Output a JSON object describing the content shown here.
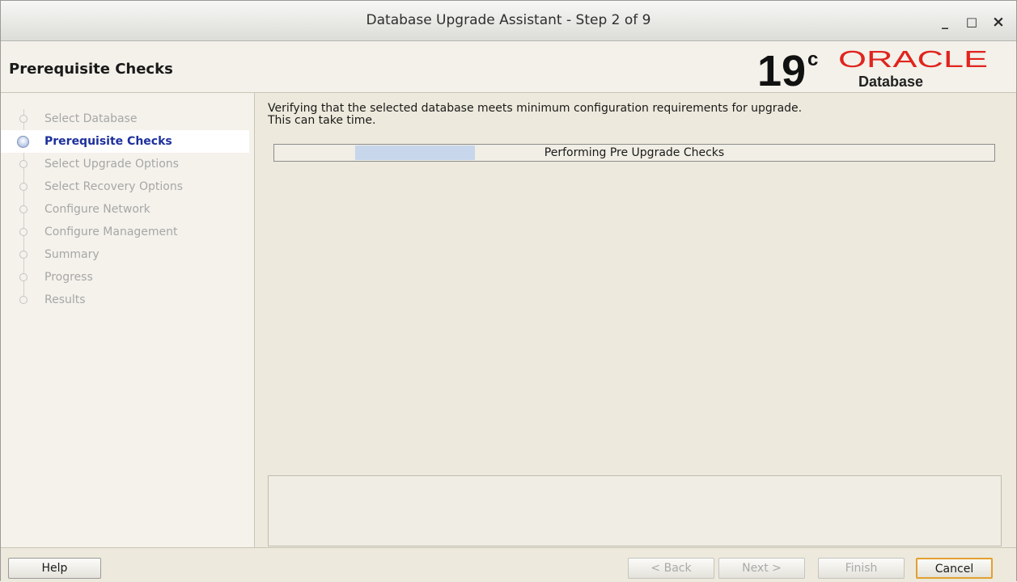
{
  "window": {
    "title": "Database Upgrade Assistant - Step 2 of 9",
    "minimize": "_",
    "maximize": "□",
    "close": "×"
  },
  "header": {
    "page_title": "Prerequisite Checks",
    "logo": {
      "version": "19",
      "version_sup": "c",
      "brand": "ORACLE",
      "product": "Database"
    }
  },
  "sidebar": {
    "steps": [
      {
        "label": "Select Database",
        "active": false
      },
      {
        "label": "Prerequisite Checks",
        "active": true
      },
      {
        "label": "Select Upgrade Options",
        "active": false
      },
      {
        "label": "Select Recovery Options",
        "active": false
      },
      {
        "label": "Configure Network",
        "active": false
      },
      {
        "label": "Configure Management",
        "active": false
      },
      {
        "label": "Summary",
        "active": false
      },
      {
        "label": "Progress",
        "active": false
      },
      {
        "label": "Results",
        "active": false
      }
    ]
  },
  "main": {
    "description_line1": "Verifying that the selected database meets minimum configuration requirements for upgrade.",
    "description_line2": "This can take time.",
    "progress": {
      "label": "Performing Pre Upgrade Checks",
      "indeterminate": true
    }
  },
  "footer": {
    "help": "Help",
    "back": "< Back",
    "next": "Next >",
    "finish": "Finish",
    "cancel": "Cancel"
  },
  "colors": {
    "active_step": "#1d2f9c",
    "oracle_red": "#e0241e",
    "progress_fill": "#c7d6ea",
    "cancel_border": "#e2a030"
  }
}
